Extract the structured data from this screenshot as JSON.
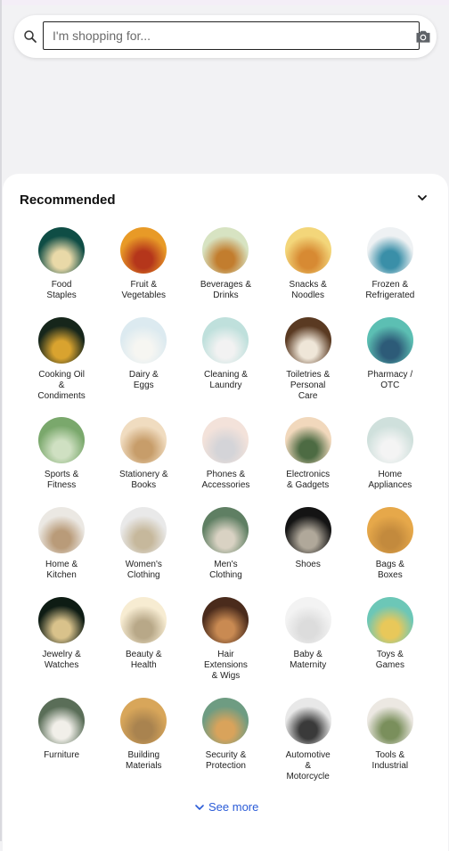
{
  "search": {
    "placeholder": "I'm shopping for..."
  },
  "recommended": {
    "title": "Recommended",
    "see_more": "See more",
    "items": [
      {
        "label": "Food\nStaples",
        "colors": [
          "#0f4d45",
          "#e9d9a8"
        ]
      },
      {
        "label": "Fruit &\nVegetables",
        "colors": [
          "#e89a27",
          "#b5361b"
        ]
      },
      {
        "label": "Beverages &\nDrinks",
        "colors": [
          "#d7e3c2",
          "#c27d2e"
        ]
      },
      {
        "label": "Snacks &\nNoodles",
        "colors": [
          "#f3d67a",
          "#d78a33"
        ]
      },
      {
        "label": "Frozen &\nRefrigerated",
        "colors": [
          "#eef1f3",
          "#3a8fa8"
        ]
      },
      {
        "label": "Cooking Oil\n&\nCondiments",
        "colors": [
          "#16261b",
          "#d9a32f"
        ]
      },
      {
        "label": "Dairy &\nEggs",
        "colors": [
          "#dceaf0",
          "#f6f6f2"
        ]
      },
      {
        "label": "Cleaning &\nLaundry",
        "colors": [
          "#bfe0dc",
          "#f2f2f2"
        ]
      },
      {
        "label": "Toiletries &\nPersonal\nCare",
        "colors": [
          "#5a3a22",
          "#efe6d8"
        ]
      },
      {
        "label": "Pharmacy /\nOTC",
        "colors": [
          "#5cbfb3",
          "#2d5b78"
        ]
      },
      {
        "label": "Sports &\nFitness",
        "colors": [
          "#7aa86c",
          "#cfe0c2"
        ]
      },
      {
        "label": "Stationery &\nBooks",
        "colors": [
          "#f0dcc0",
          "#c79d6a"
        ]
      },
      {
        "label": "Phones &\nAccessories",
        "colors": [
          "#f3e2da",
          "#d4d4d8"
        ]
      },
      {
        "label": "Electronics\n& Gadgets",
        "colors": [
          "#f1d8bc",
          "#4d6b43"
        ]
      },
      {
        "label": "Home\nAppliances",
        "colors": [
          "#cfe0dc",
          "#f4f4f4"
        ]
      },
      {
        "label": "Home &\nKitchen",
        "colors": [
          "#ebe8e3",
          "#b99b79"
        ]
      },
      {
        "label": "Women's\nClothing",
        "colors": [
          "#e9e9e9",
          "#c6b89c"
        ]
      },
      {
        "label": "Men's\nClothing",
        "colors": [
          "#5f7f63",
          "#d9d2c3"
        ]
      },
      {
        "label": "Shoes",
        "colors": [
          "#141414",
          "#b0a89a"
        ]
      },
      {
        "label": "Bags &\nBoxes",
        "colors": [
          "#e6a84a",
          "#c38a3d"
        ]
      },
      {
        "label": "Jewelry &\nWatches",
        "colors": [
          "#0e1c14",
          "#d9c28b"
        ]
      },
      {
        "label": "Beauty &\nHealth",
        "colors": [
          "#f7ecd2",
          "#b8a888"
        ]
      },
      {
        "label": "Hair\nExtensions\n& Wigs",
        "colors": [
          "#4a2b1c",
          "#c98a52"
        ]
      },
      {
        "label": "Baby &\nMaternity",
        "colors": [
          "#f3f3f3",
          "#dcdcdc"
        ]
      },
      {
        "label": "Toys &\nGames",
        "colors": [
          "#6cc7b7",
          "#e8c85a"
        ]
      },
      {
        "label": "Furniture",
        "colors": [
          "#5a6e58",
          "#f1efe9"
        ]
      },
      {
        "label": "Building\nMaterials",
        "colors": [
          "#d8a65a",
          "#a9834f"
        ]
      },
      {
        "label": "Security &\nProtection",
        "colors": [
          "#6e9c82",
          "#d9a35b"
        ]
      },
      {
        "label": "Automotive\n&\nMotorcycle",
        "colors": [
          "#e8e8e8",
          "#3a3a3a"
        ]
      },
      {
        "label": "Tools &\nIndustrial",
        "colors": [
          "#ece8e2",
          "#7a8f5c"
        ]
      }
    ]
  },
  "icons": {
    "search": "search-icon",
    "camera": "camera-icon",
    "collapse": "chevron-down-icon",
    "see_more": "chevron-down-icon"
  },
  "accent_color": "#2a5bd7"
}
